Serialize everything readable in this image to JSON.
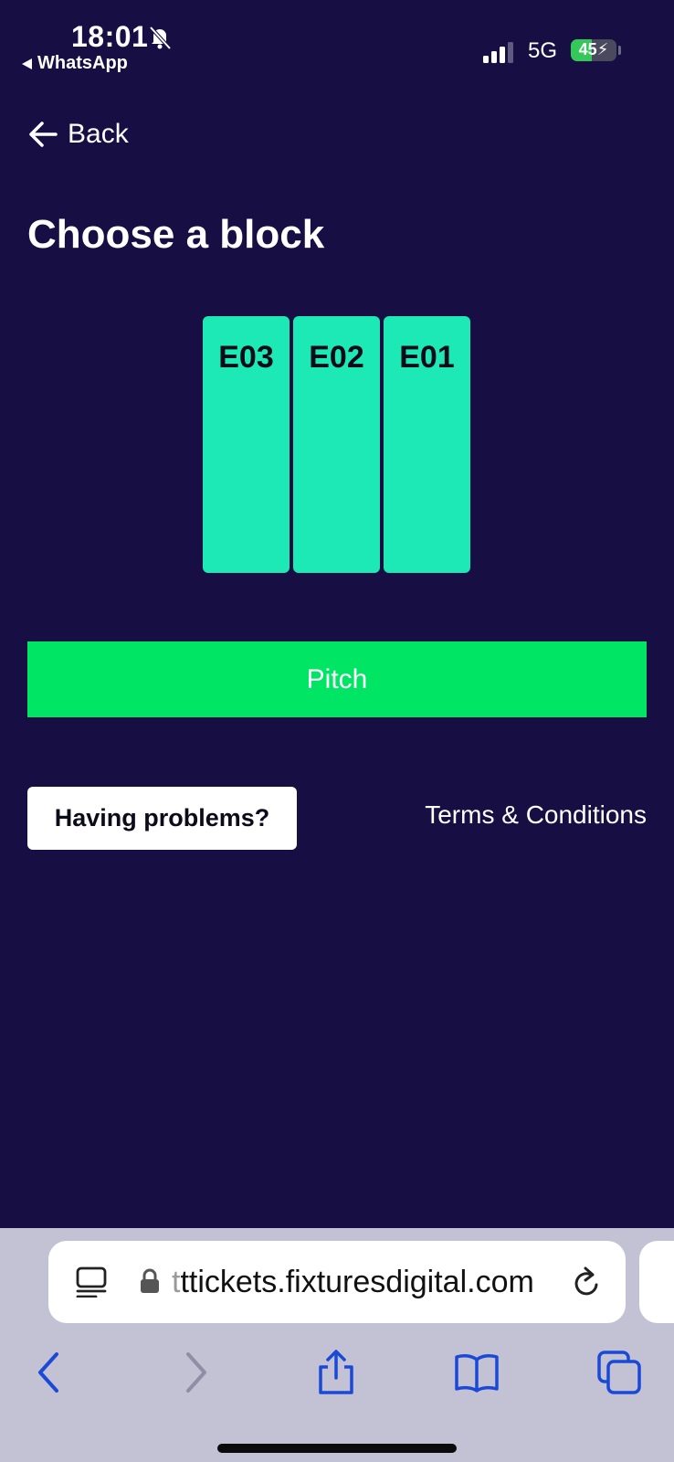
{
  "status_bar": {
    "time": "18:01",
    "back_app": "WhatsApp",
    "network": "5G",
    "battery": "45",
    "battery_level": 0.45,
    "icons": [
      "bell-slash-icon",
      "signal-icon",
      "battery-icon"
    ]
  },
  "nav": {
    "back_label": "Back",
    "back_icon": "arrow-left-icon"
  },
  "page": {
    "title": "Choose a block"
  },
  "blocks": {
    "color": "#1de9b6",
    "items": [
      {
        "label": "E03"
      },
      {
        "label": "E02"
      },
      {
        "label": "E01"
      }
    ]
  },
  "pitch": {
    "label": "Pitch",
    "color": "#00e564"
  },
  "footer": {
    "help_label": "Having problems?",
    "terms_label": "Terms & Conditions"
  },
  "browser": {
    "url_faded": "t",
    "url": "ttickets.fixturesdigital.com",
    "toolbar_icons": [
      "back-icon",
      "forward-icon",
      "share-icon",
      "bookmarks-icon",
      "tabs-icon"
    ]
  },
  "colors": {
    "background": "#170f44",
    "browser_chrome": "#c3c1d4",
    "toolbar_icon": "#1a49d6"
  }
}
